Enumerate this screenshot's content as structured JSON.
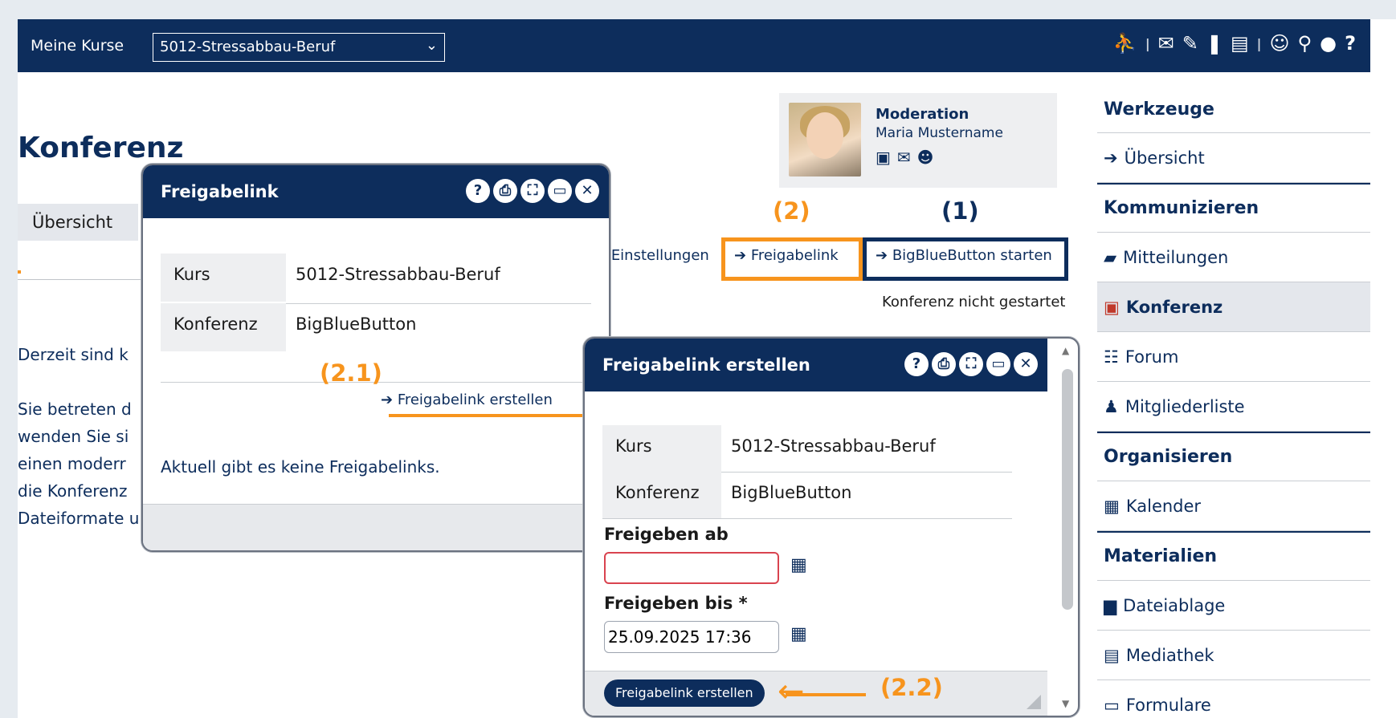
{
  "topbar": {
    "my_courses_label": "Meine Kurse",
    "course_selected": "5012-Stressabbau-Beruf",
    "icons": [
      "person-walk-icon",
      "envelope-icon",
      "edit-icon",
      "bookmark-icon",
      "document-icon",
      "user-icon",
      "link-icon",
      "help-p-icon",
      "question-icon"
    ]
  },
  "page": {
    "title": "Konferenz",
    "tab_overview": "Übersicht",
    "body_lines": [
      "Derzeit sind k",
      "Sie betreten d",
      "wenden Sie si",
      "einen moderr",
      "die Konferenz",
      "Dateiformate unterstützt. Häufige Fragen zur Nutzung der Kon"
    ]
  },
  "moderation": {
    "title": "Moderation",
    "name": "Maria Mustername"
  },
  "actions": {
    "settings": "Einstellungen",
    "share_link": "Freigabelink",
    "start_bbb": "BigBlueButton starten",
    "status": "Konferenz nicht gestartet"
  },
  "callouts": {
    "c1": "(1)",
    "c2": "(2)",
    "c21": "(2.1)",
    "c22": "(2.2)"
  },
  "sidebar": {
    "werkzeuge": "Werkzeuge",
    "uebersicht": "Übersicht",
    "kommunizieren": "Kommunizieren",
    "mitteilungen": "Mitteilungen",
    "konferenz": "Konferenz",
    "forum": "Forum",
    "mitgliederliste": "Mitgliederliste",
    "organisieren": "Organisieren",
    "kalender": "Kalender",
    "materialien": "Materialien",
    "dateiablage": "Dateiablage",
    "mediathek": "Mediathek",
    "formulare": "Formulare"
  },
  "dialog1": {
    "title": "Freigabelink",
    "kurs_label": "Kurs",
    "kurs_value": "5012-Stressabbau-Beruf",
    "konf_label": "Konferenz",
    "konf_value": "BigBlueButton",
    "create_link": "Freigabelink erstellen",
    "empty": "Aktuell gibt es keine Freigabelinks."
  },
  "dialog2": {
    "title": "Freigabelink erstellen",
    "kurs_label": "Kurs",
    "kurs_value": "5012-Stressabbau-Beruf",
    "konf_label": "Konferenz",
    "konf_value": "BigBlueButton",
    "from_label": "Freigeben ab",
    "from_value": "",
    "until_label": "Freigeben bis *",
    "until_value": "25.09.2025 17:36",
    "create_button": "Freigabelink erstellen"
  },
  "colors": {
    "navy": "#0d2d5c",
    "orange": "#f7941d",
    "error": "#d9434f"
  }
}
